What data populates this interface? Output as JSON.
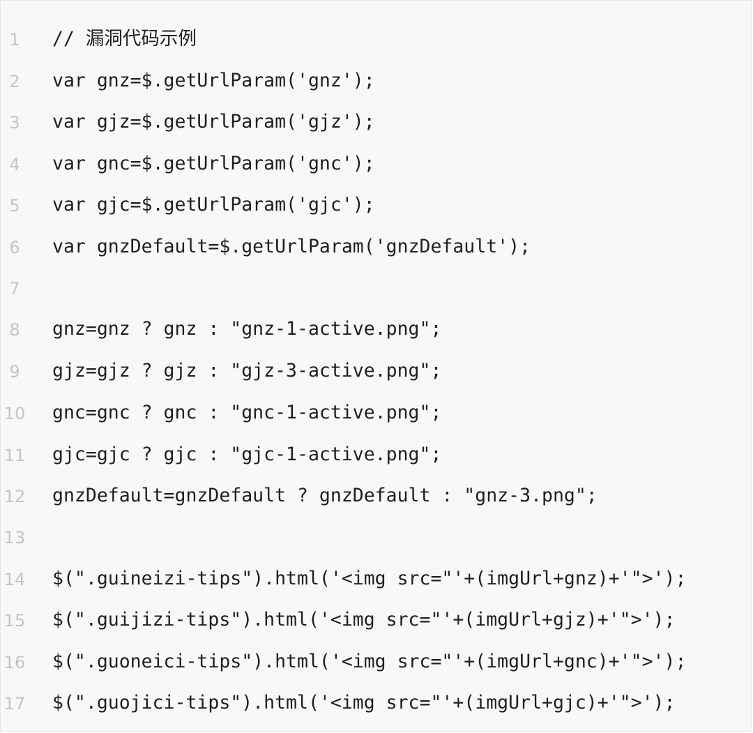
{
  "code": {
    "lines": [
      {
        "num": "1",
        "text": "// 漏洞代码示例"
      },
      {
        "num": "2",
        "text": "var gnz=$.getUrlParam('gnz');"
      },
      {
        "num": "3",
        "text": "var gjz=$.getUrlParam('gjz');"
      },
      {
        "num": "4",
        "text": "var gnc=$.getUrlParam('gnc');"
      },
      {
        "num": "5",
        "text": "var gjc=$.getUrlParam('gjc');"
      },
      {
        "num": "6",
        "text": "var gnzDefault=$.getUrlParam('gnzDefault');"
      },
      {
        "num": "7",
        "text": ""
      },
      {
        "num": "8",
        "text": "gnz=gnz ? gnz : \"gnz-1-active.png\";"
      },
      {
        "num": "9",
        "text": "gjz=gjz ? gjz : \"gjz-3-active.png\";"
      },
      {
        "num": "10",
        "text": "gnc=gnc ? gnc : \"gnc-1-active.png\";"
      },
      {
        "num": "11",
        "text": "gjc=gjc ? gjc : \"gjc-1-active.png\";"
      },
      {
        "num": "12",
        "text": "gnzDefault=gnzDefault ? gnzDefault : \"gnz-3.png\";"
      },
      {
        "num": "13",
        "text": ""
      },
      {
        "num": "14",
        "text": "$(\".guineizi-tips\").html('<img src=\"'+(imgUrl+gnz)+'\">');"
      },
      {
        "num": "15",
        "text": "$(\".guijizi-tips\").html('<img src=\"'+(imgUrl+gjz)+'\">');"
      },
      {
        "num": "16",
        "text": "$(\".guoneici-tips\").html('<img src=\"'+(imgUrl+gnc)+'\">');"
      },
      {
        "num": "17",
        "text": "$(\".guojici-tips\").html('<img src=\"'+(imgUrl+gjc)+'\">');"
      }
    ]
  }
}
